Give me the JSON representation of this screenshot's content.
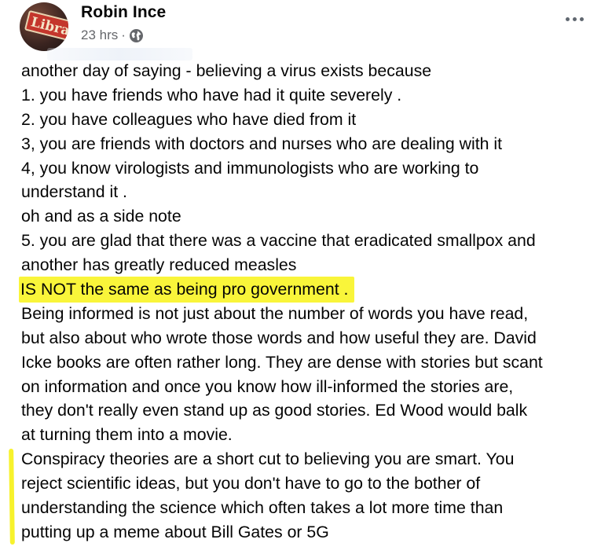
{
  "author": {
    "name": "Robin Ince",
    "avatar_sign_text": "Librar"
  },
  "meta": {
    "time": "23 hrs",
    "separator": "·",
    "audience_icon": "globe-icon"
  },
  "actions": {
    "more_icon": "ellipsis-icon"
  },
  "post": {
    "lines": [
      "another day of saying - believing a virus exists because",
      "1. you have friends who have had it quite severely .",
      "2. you have colleagues who have died from it",
      "3, you are friends with doctors and nurses who are dealing with it",
      "4, you know virologists and immunologists who are working to",
      "understand it .",
      "oh and as a side note",
      "5. you are glad that there was a vaccine that eradicated smallpox and",
      "another has greatly reduced measles",
      "IS NOT the same as being pro government .",
      "Being informed is not just about the number of words you have read,",
      "but also about who wrote those words and how useful they are. David",
      "Icke books are often rather long. They are dense with stories but scant",
      "on information and once you know how ill-informed the stories are,",
      "they don't really even stand up as good stories. Ed Wood would balk",
      "at turning them into a movie.",
      "Conspiracy theories are a short cut to believing you are smart. You",
      "reject scientific ideas, but you don't have to go to the bother of",
      "understanding the science which often takes a lot more time than",
      "putting up a meme about Bill Gates or 5G"
    ]
  },
  "colors": {
    "highlight": "#f9f53a",
    "meta_text": "#65676b",
    "body_text": "#050505"
  }
}
